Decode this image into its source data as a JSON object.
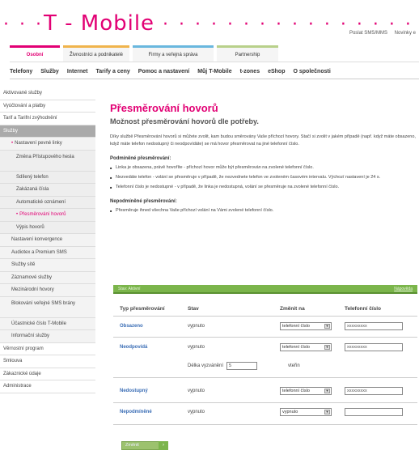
{
  "brand": {
    "logo": "T - Mobile",
    "color": "#e20074"
  },
  "toplinks": [
    "Poslat SMS/MMS",
    "Novinky e"
  ],
  "segments": [
    "Osobní",
    "Živnostníci a podnikatelé",
    "Firmy a veřejná správa",
    "Partnership"
  ],
  "mainnav": [
    "Telefony",
    "Služby",
    "Internet",
    "Tarify a ceny",
    "Pomoc a nastavení",
    "Můj T-Mobile",
    "t-zones",
    "eShop",
    "O společnosti"
  ],
  "sidebar": [
    "Aktivované služby",
    "Vyúčtování a platby",
    "Tarif a Tarifní zvýhodnění",
    "Služby",
    "Nastavení pevné linky",
    "Změna Přístupového hesla",
    "Sdílený telefon",
    "Zakázaná čísla",
    "Automatické oznámení",
    "Přesměrování hovorů",
    "Výpis hovorů",
    "Nastavení konvergence",
    "Audiotex a Premium SMS",
    "Služby sítě",
    "Záznamové služby",
    "Mezinárodní hovory",
    "Blokování veřejné SMS brány",
    "Účastnické číslo T-Mobile",
    "Informační služby",
    "Věrnostní program",
    "Smlouva",
    "Zákaznické údaje",
    "Administrace"
  ],
  "page": {
    "title": "Přesměrování hovorů",
    "subtitle": "Možnost přesměrování hovorů dle potřeby.",
    "intro": "Díky službě Přesměrování hovorů si můžete zvolit, kam budou směrovány Vaše příchozí hovory. Stačí si zvolit v jakém případě (např. když máte obsazeno, když máte telefon nedostupný či neodpovídáte) se má hovor přesměrovat na jiné telefonní číslo.",
    "cond_heading": "Podmíněné přesměrování:",
    "cond_items": [
      "Linka je obsazena, právě hovoříte - příchozí hovor může být přesměrován na zvolené telefonní číslo.",
      "Nezvedáte telefon - volání se přesměruje v případě, že nezvednete telefon ve zvoleném časovém intervalu. Výchozí nastavení je 24 s.",
      "Telefonní číslo je nedostupné - v případě, že linka je nedostupná, volání se přesměruje na zvolené telefonní číslo."
    ],
    "uncond_heading": "Nepodmíněné přesměrování:",
    "uncond_items": [
      "Přesměruje ihned všechna Vaše příchozí volání na Vámi zvolené telefonní číslo."
    ]
  },
  "form": {
    "bar_left": "Stav: Aktivní",
    "bar_right": "Nápověda",
    "headers": [
      "Typ přesměrování",
      "Stav",
      "Změnit na",
      "Telefonní číslo"
    ],
    "rows": [
      {
        "type": "Obsazeno",
        "state": "vypnuto",
        "change": "telefonní číslo",
        "phone": "xxxxxxxxx"
      },
      {
        "type": "Neodpovídá",
        "state": "vypnuto",
        "change": "telefonní číslo",
        "phone": "xxxxxxxxx"
      },
      {
        "type": "Nedostupný",
        "state": "vypnuto",
        "change": "telefonní číslo",
        "phone": "xxxxxxxxx"
      },
      {
        "type": "Nepodmíněné",
        "state": "vypnuto",
        "change": "vypnuto",
        "phone": ""
      }
    ],
    "ring_label": "Délka vyzvánění",
    "ring_value": "5",
    "ring_unit": "vteřin",
    "submit": "Změnit"
  }
}
